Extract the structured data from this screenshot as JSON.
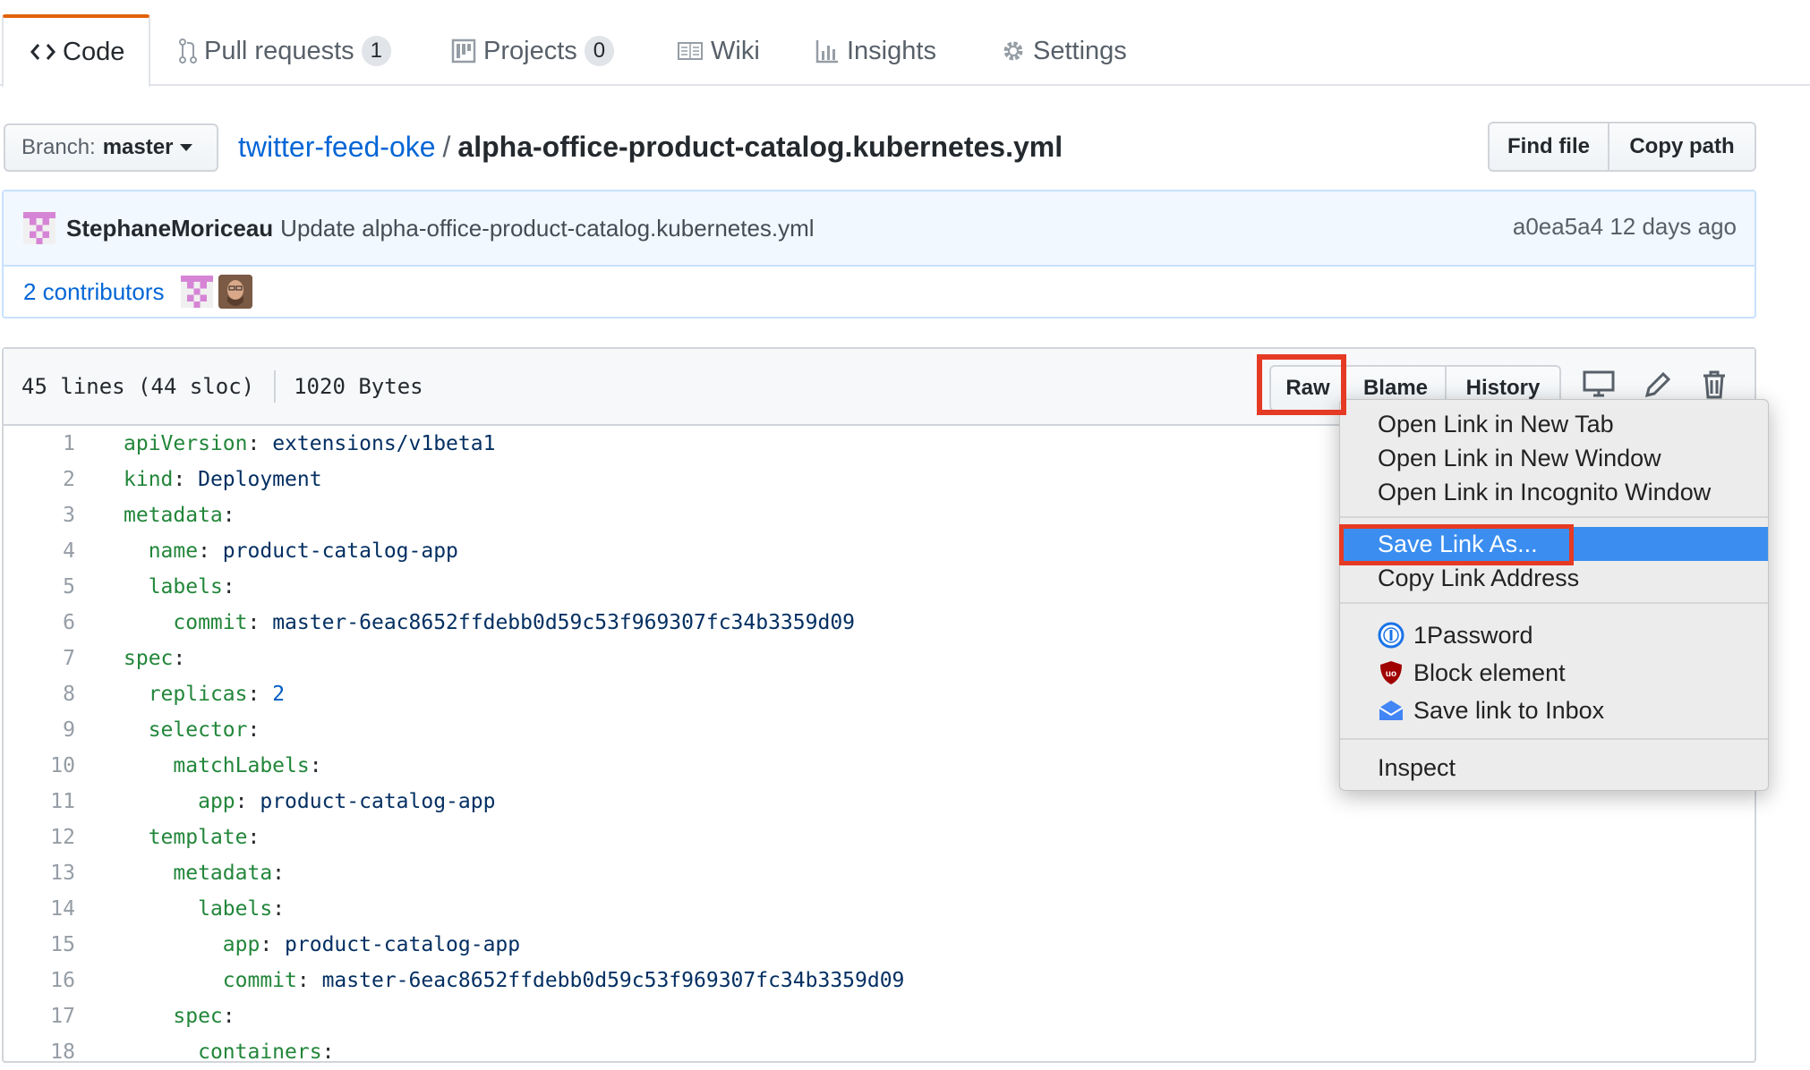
{
  "tabs": [
    {
      "label": "Code",
      "icon": "code-icon",
      "active": true
    },
    {
      "label": "Pull requests",
      "icon": "pull-request-icon",
      "count": "1"
    },
    {
      "label": "Projects",
      "icon": "project-icon",
      "count": "0"
    },
    {
      "label": "Wiki",
      "icon": "book-icon"
    },
    {
      "label": "Insights",
      "icon": "graph-icon"
    },
    {
      "label": "Settings",
      "icon": "gear-icon"
    }
  ],
  "branch": {
    "label": "Branch:",
    "name": "master"
  },
  "breadcrumb": {
    "repo": "twitter-feed-oke",
    "separator": "/",
    "file": "alpha-office-product-catalog.kubernetes.yml"
  },
  "actions": {
    "find_file": "Find file",
    "copy_path": "Copy path"
  },
  "commit": {
    "author": "StephaneMoriceau",
    "message": "Update alpha-office-product-catalog.kubernetes.yml",
    "sha": "a0ea5a4",
    "age": "12 days ago",
    "contributors": "2 contributors"
  },
  "file": {
    "lines_info": "45 lines (44 sloc)",
    "size": "1020 Bytes",
    "raw": "Raw",
    "blame": "Blame",
    "history": "History"
  },
  "code": [
    {
      "num": "1",
      "indent": "",
      "key": "apiVersion",
      "value": " extensions/v1beta1"
    },
    {
      "num": "2",
      "indent": "",
      "key": "kind",
      "value": " Deployment"
    },
    {
      "num": "3",
      "indent": "",
      "key": "metadata",
      "value": ""
    },
    {
      "num": "4",
      "indent": "  ",
      "key": "name",
      "value": " product-catalog-app"
    },
    {
      "num": "5",
      "indent": "  ",
      "key": "labels",
      "value": ""
    },
    {
      "num": "6",
      "indent": "    ",
      "key": "commit",
      "value": " master-6eac8652ffdebb0d59c53f969307fc34b3359d09"
    },
    {
      "num": "7",
      "indent": "",
      "key": "spec",
      "value": ""
    },
    {
      "num": "8",
      "indent": "  ",
      "key": "replicas",
      "value": " 2",
      "numeric": true
    },
    {
      "num": "9",
      "indent": "  ",
      "key": "selector",
      "value": ""
    },
    {
      "num": "10",
      "indent": "    ",
      "key": "matchLabels",
      "value": ""
    },
    {
      "num": "11",
      "indent": "      ",
      "key": "app",
      "value": " product-catalog-app"
    },
    {
      "num": "12",
      "indent": "  ",
      "key": "template",
      "value": ""
    },
    {
      "num": "13",
      "indent": "    ",
      "key": "metadata",
      "value": ""
    },
    {
      "num": "14",
      "indent": "      ",
      "key": "labels",
      "value": ""
    },
    {
      "num": "15",
      "indent": "        ",
      "key": "app",
      "value": " product-catalog-app"
    },
    {
      "num": "16",
      "indent": "        ",
      "key": "commit",
      "value": " master-6eac8652ffdebb0d59c53f969307fc34b3359d09"
    },
    {
      "num": "17",
      "indent": "    ",
      "key": "spec",
      "value": ""
    },
    {
      "num": "18",
      "indent": "      ",
      "key": "containers",
      "value": ""
    }
  ],
  "context_menu": {
    "open_new_tab": "Open Link in New Tab",
    "open_new_window": "Open Link in New Window",
    "open_incognito": "Open Link in Incognito Window",
    "save_link_as": "Save Link As...",
    "copy_link_address": "Copy Link Address",
    "onepassword": "1Password",
    "block_element": "Block element",
    "save_to_inbox": "Save link to Inbox",
    "inspect": "Inspect"
  },
  "colors": {
    "accent_tab": "#e36209",
    "link": "#0366d6",
    "highlight_box": "#e53a23",
    "menu_selection": "#3b8ef0"
  }
}
